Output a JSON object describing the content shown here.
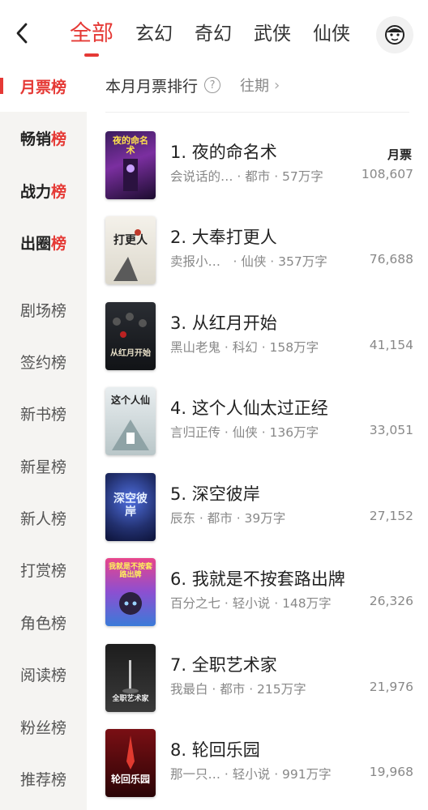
{
  "header": {
    "back_icon": "chevron-left-icon",
    "tabs": [
      {
        "label": "全部",
        "active": true
      },
      {
        "label": "玄幻"
      },
      {
        "label": "奇幻"
      },
      {
        "label": "武侠"
      },
      {
        "label": "仙侠"
      }
    ],
    "avatar_icon": "monkey-avatar-icon",
    "accent_color": "#e53935"
  },
  "sidebar": {
    "items": [
      {
        "pre": "月票",
        "hl": "榜"
      },
      {
        "pre": "畅销",
        "hl": "榜"
      },
      {
        "pre": "战力",
        "hl": "榜"
      },
      {
        "pre": "出圈",
        "hl": "榜"
      },
      {
        "label": "剧场榜"
      },
      {
        "label": "签约榜"
      },
      {
        "label": "新书榜"
      },
      {
        "label": "新星榜"
      },
      {
        "label": "新人榜"
      },
      {
        "label": "打赏榜"
      },
      {
        "label": "角色榜"
      },
      {
        "label": "阅读榜"
      },
      {
        "label": "粉丝榜"
      },
      {
        "label": "推荐榜"
      }
    ],
    "active_label": "月票榜"
  },
  "content": {
    "subhead_title": "本月月票排行",
    "help_glyph": "?",
    "past_label": "往期",
    "past_arrow": "›",
    "metric_label": "月票",
    "books": [
      {
        "title": "1. 夜的命名术",
        "meta": "会说话的… · 都市 · 57万字",
        "count": "108,607",
        "cover_text": "夜的命名术"
      },
      {
        "title": "2. 大奉打更人",
        "meta": "卖报小…　· 仙侠 · 357万字",
        "count": "76,688",
        "cover_text": "打更人"
      },
      {
        "title": "3. 从红月开始",
        "meta": "黑山老鬼 · 科幻 · 158万字",
        "count": "41,154",
        "cover_text": "从红月开始"
      },
      {
        "title": "4. 这个人仙太过正经",
        "meta": "言归正传 · 仙侠 · 136万字",
        "count": "33,051",
        "cover_text": "这个人仙"
      },
      {
        "title": "5. 深空彼岸",
        "meta": "辰东 · 都市 · 39万字",
        "count": "27,152",
        "cover_text": "深空彼岸"
      },
      {
        "title": "6. 我就是不按套路出牌",
        "meta": "百分之七 · 轻小说 · 148万字",
        "count": "26,326",
        "cover_text": "我就是不按套路出牌"
      },
      {
        "title": "7. 全职艺术家",
        "meta": "我最白 · 都市 · 215万字",
        "count": "21,976",
        "cover_text": "全职艺术家"
      },
      {
        "title": "8. 轮回乐园",
        "meta": "那一只… · 轻小说 · 991万字",
        "count": "19,968",
        "cover_text": "轮回乐园"
      }
    ]
  }
}
